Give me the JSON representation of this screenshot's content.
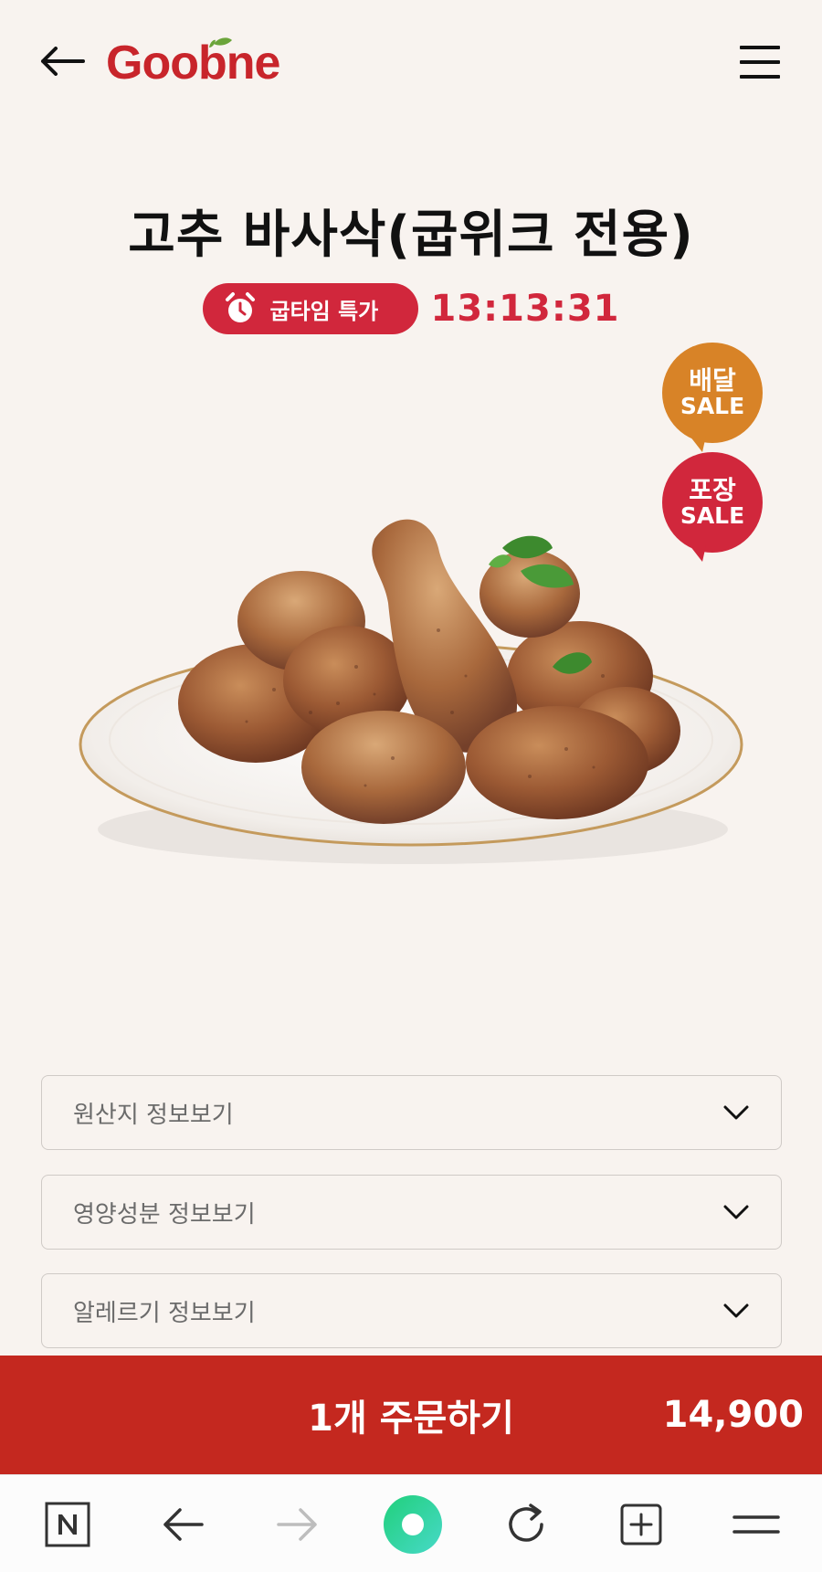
{
  "header": {
    "logo_text": "Goobne",
    "back_icon": "arrow-left-icon",
    "menu_icon": "hamburger-menu-icon"
  },
  "product": {
    "title": "고추 바사삭(굽위크 전용)",
    "promo_badge": "굽타임 특가",
    "countdown": "13:13:31",
    "sale_delivery": {
      "line1": "배달",
      "line2": "SALE"
    },
    "sale_takeout": {
      "line1": "포장",
      "line2": "SALE"
    }
  },
  "accordions": [
    {
      "label": "원산지 정보보기"
    },
    {
      "label": "영양성분 정보보기"
    },
    {
      "label": "알레르기 정보보기"
    }
  ],
  "order": {
    "label": "1개 주문하기",
    "price": "14,900"
  },
  "browser_bar": {
    "icons": [
      "naver-n-icon",
      "back-arrow-icon",
      "forward-arrow-icon",
      "home-circle-icon",
      "refresh-icon",
      "new-tab-icon",
      "menu-icon"
    ]
  },
  "colors": {
    "brand_red": "#c8252b",
    "promo_red": "#d1273c",
    "order_bar": "#c4281f",
    "delivery_orange": "#d88327",
    "background": "#f8f3ef",
    "home_green": "#2fd28a"
  }
}
